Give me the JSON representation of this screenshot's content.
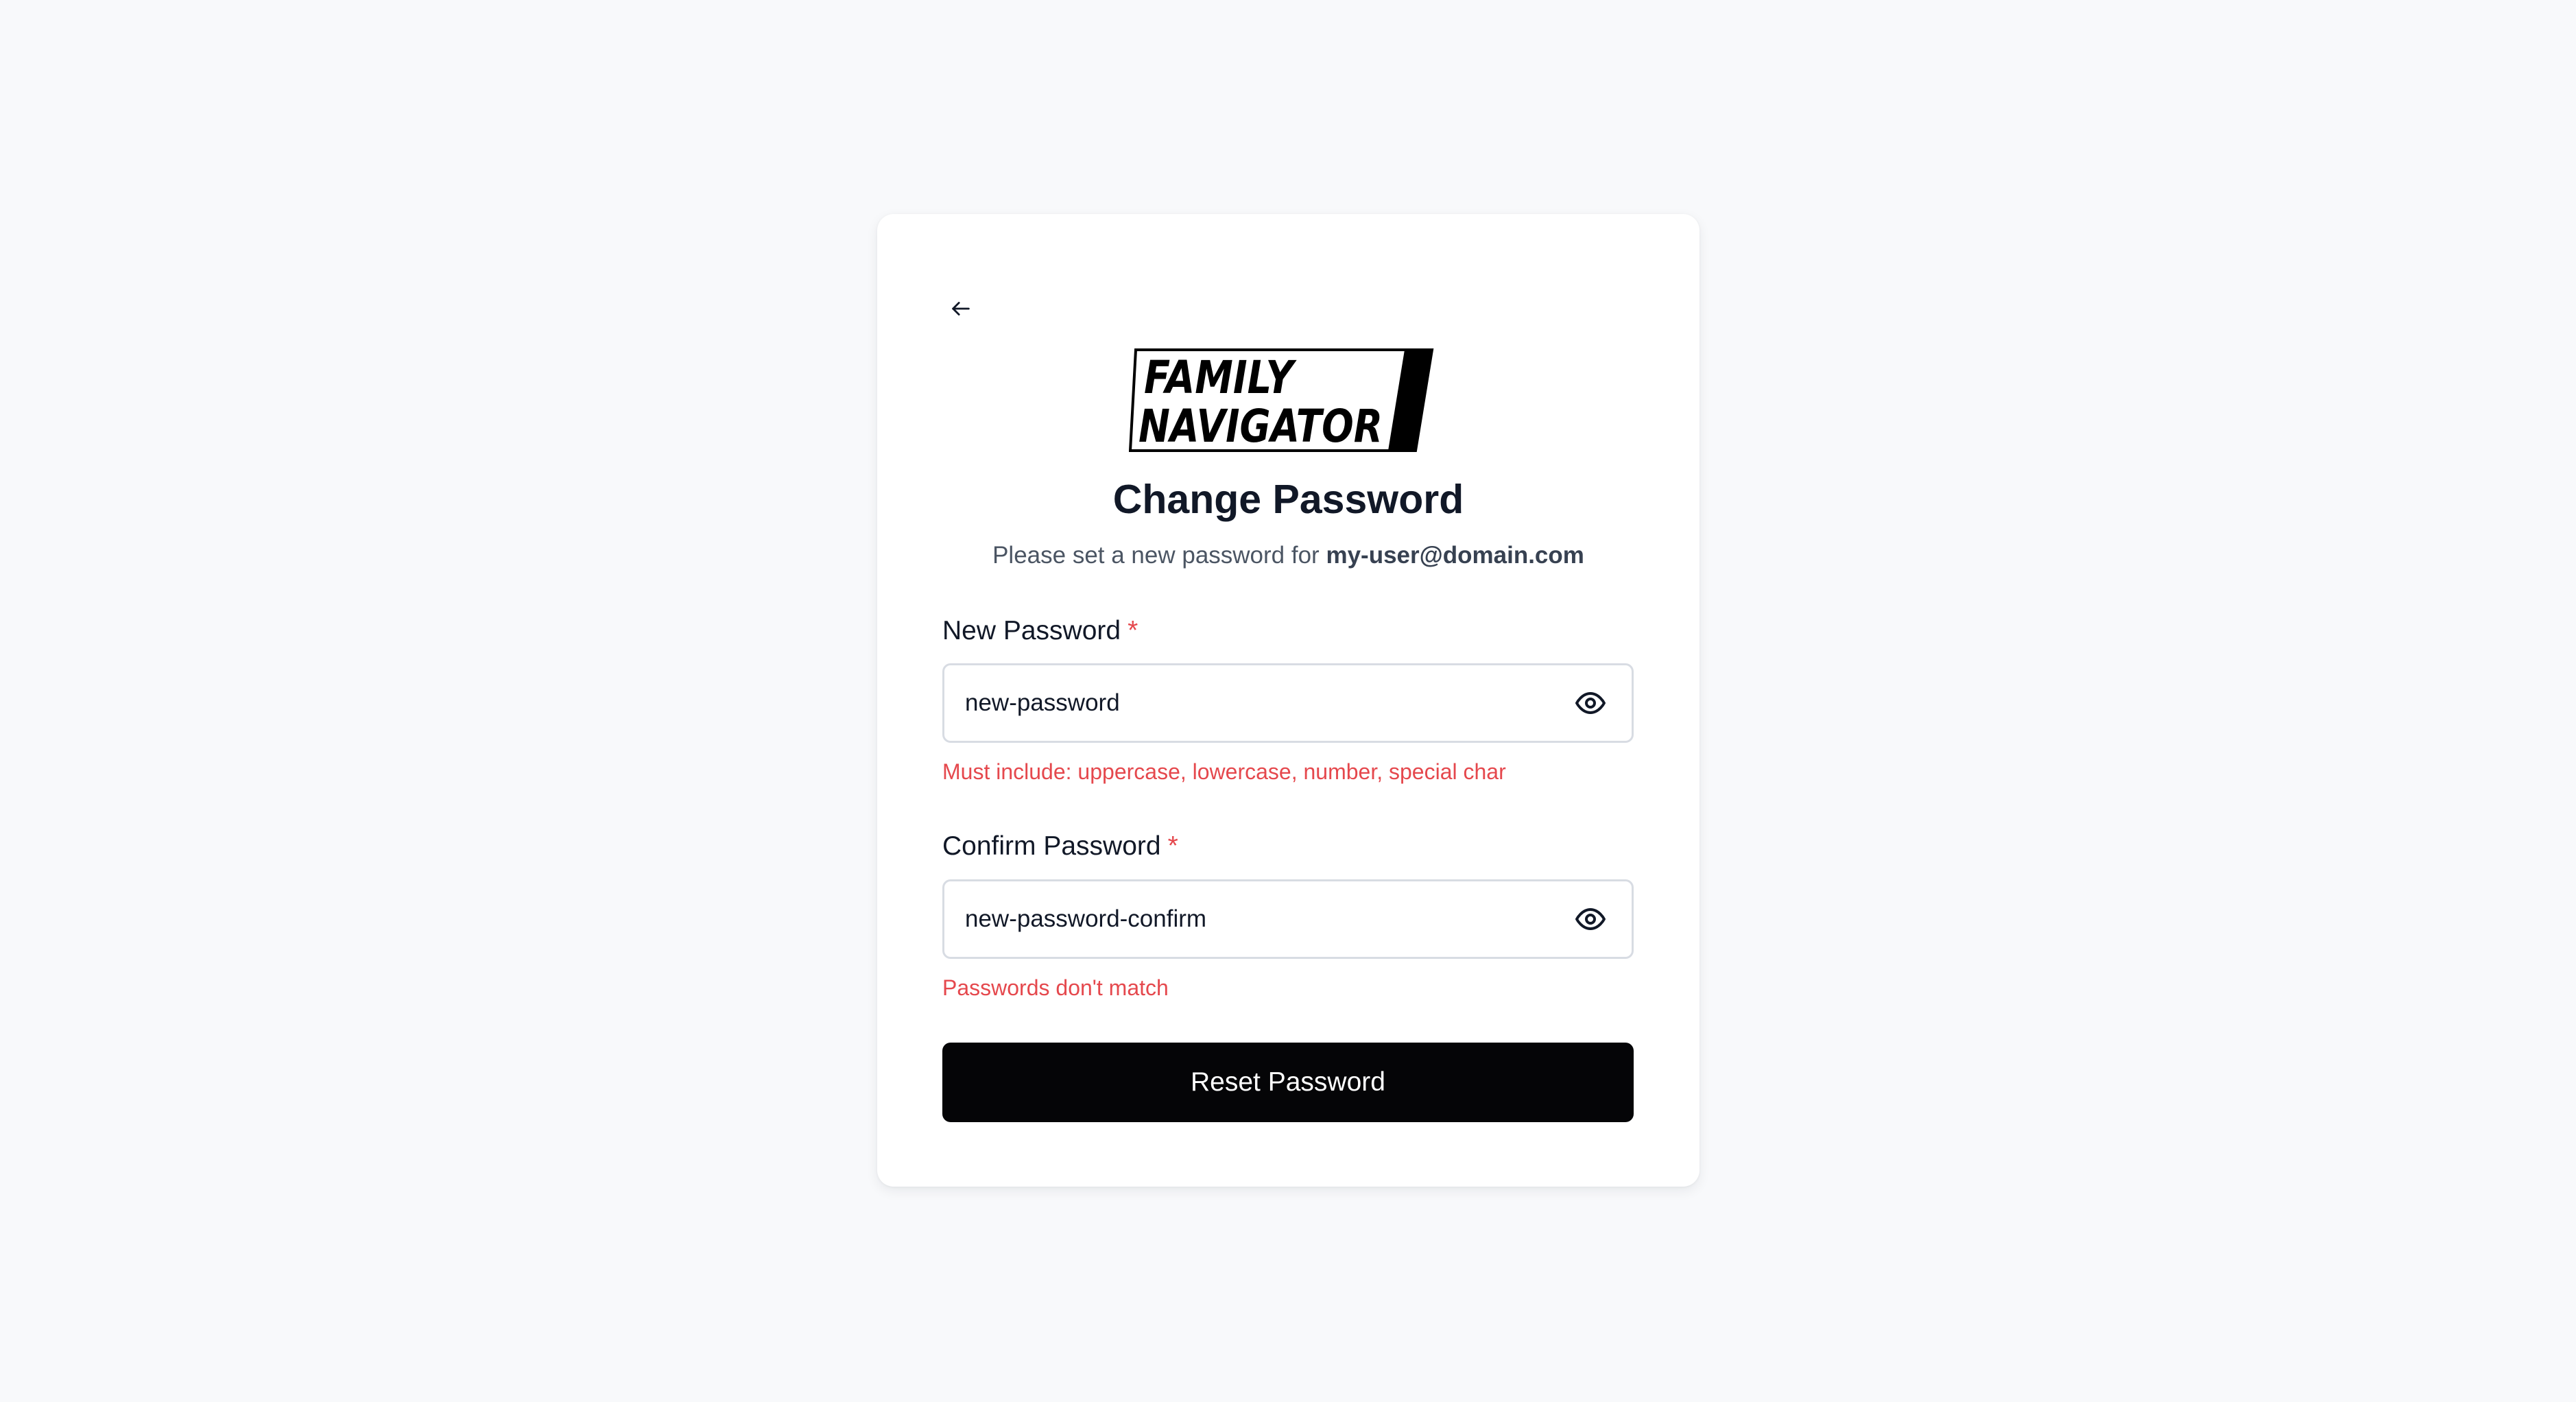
{
  "logo": {
    "line1": "FAMILY",
    "line2": "NAVIGATOR"
  },
  "header": {
    "title": "Change Password",
    "subtitle_prefix": "Please set a new password for",
    "email": "my-user@domain.com"
  },
  "form": {
    "new_password": {
      "label": "New Password",
      "required_mark": "*",
      "value": "new-password",
      "error": "Must include: uppercase, lowercase, number, special char"
    },
    "confirm_password": {
      "label": "Confirm Password",
      "required_mark": "*",
      "value": "new-password-confirm",
      "error": "Passwords don't match"
    },
    "submit_label": "Reset Password"
  },
  "icons": {
    "back": "arrow-left-icon",
    "toggle_visibility": "eye-icon"
  },
  "colors": {
    "background": "#f8f9fb",
    "card": "#ffffff",
    "error": "#e5484d",
    "button": "#050507",
    "input_border": "#d8dce3",
    "text_primary": "#111827",
    "text_secondary": "#4b5563"
  }
}
